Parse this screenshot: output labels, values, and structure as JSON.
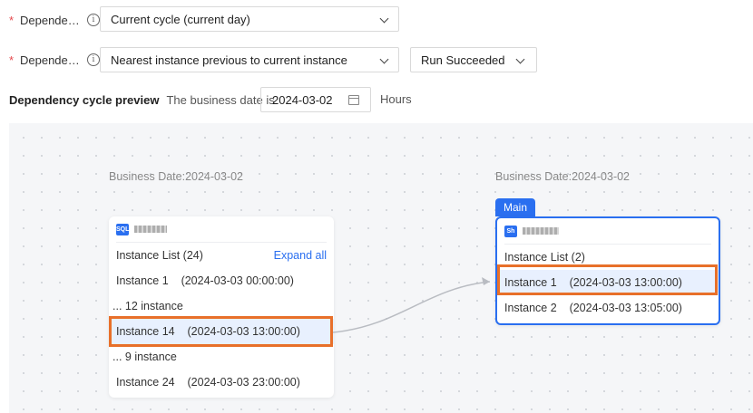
{
  "form": {
    "row1": {
      "label": "Depende…",
      "value": "Current cycle (current day)"
    },
    "row2": {
      "label": "Depende…",
      "value": "Nearest instance previous to current instance",
      "status_value": "Run Succeeded"
    },
    "required_mark": "*",
    "info_icon": "i"
  },
  "preview": {
    "title": "Dependency cycle preview",
    "business_date_label": "The business date is",
    "date_value": "2024-03-02",
    "unit": "Hours"
  },
  "upstream": {
    "business_date": "Business Date:2024-03-02",
    "tag": "SQL",
    "list_title": "Instance List (24)",
    "expand_all": "Expand all",
    "items": [
      {
        "label": "Instance 1    (2024-03-03 00:00:00)"
      },
      {
        "label": "... 12 instance"
      },
      {
        "label": "Instance 14    (2024-03-03 13:00:00)"
      },
      {
        "label": "... 9 instance"
      },
      {
        "label": "Instance 24    (2024-03-03 23:00:00)"
      }
    ]
  },
  "downstream": {
    "business_date": "Business Date:2024-03-02",
    "main_tab": "Main",
    "tag": "Sh",
    "list_title": "Instance List (2)",
    "items": [
      {
        "label": "Instance 1    (2024-03-03 13:00:00)"
      },
      {
        "label": "Instance 2    (2024-03-03 13:05:00)"
      }
    ]
  },
  "colors": {
    "accent": "#2a6ff0",
    "highlight_border": "#e8702a",
    "highlight_bg": "#e8f0fe",
    "required": "#e5484d"
  }
}
